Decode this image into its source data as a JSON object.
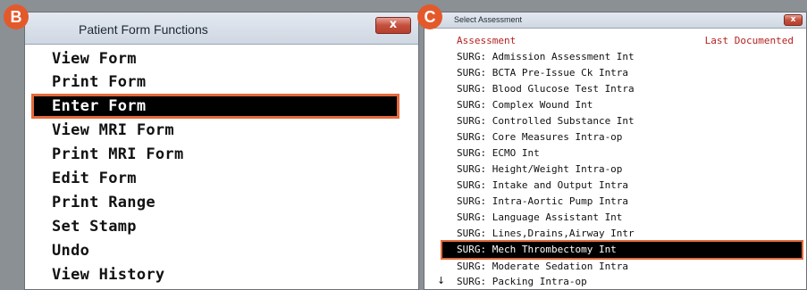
{
  "badges": {
    "b": "B",
    "c": "C"
  },
  "patient_form_functions": {
    "title": "Patient Form Functions",
    "close_label": "x",
    "items": [
      "View Form",
      "Print Form",
      "Enter Form",
      "View MRI Form",
      "Print MRI Form",
      "Edit Form",
      "Print Range",
      "Set Stamp",
      "Undo",
      "View History"
    ],
    "selected_item": "Enter Form"
  },
  "select_assessment": {
    "title": "Select Assessment",
    "close_label": "x",
    "header_assessment": "Assessment",
    "header_last_documented": "Last Documented",
    "items": [
      "SURG: Admission Assessment Int",
      "SURG: BCTA Pre-Issue Ck Intra",
      "SURG: Blood Glucose Test Intra",
      "SURG: Complex Wound Int",
      "SURG: Controlled Substance Int",
      "SURG: Core Measures Intra-op",
      "SURG: ECMO Int",
      "SURG: Height/Weight Intra-op",
      "SURG: Intake and Output Intra",
      "SURG: Intra-Aortic Pump Intra",
      "SURG: Language Assistant Int",
      "SURG: Lines,Drains,Airway Intr",
      "SURG: Mech Thrombectomy Int",
      "SURG: Moderate Sedation Intra",
      "SURG: Packing Intra-op"
    ],
    "selected_item": "SURG: Mech Thrombectomy Int",
    "scroll_indicator": "↓"
  },
  "colors": {
    "badge": "#e4592b",
    "highlight_outline": "#e46a3c",
    "header_text": "#b42121",
    "selected_bg": "#000000"
  }
}
